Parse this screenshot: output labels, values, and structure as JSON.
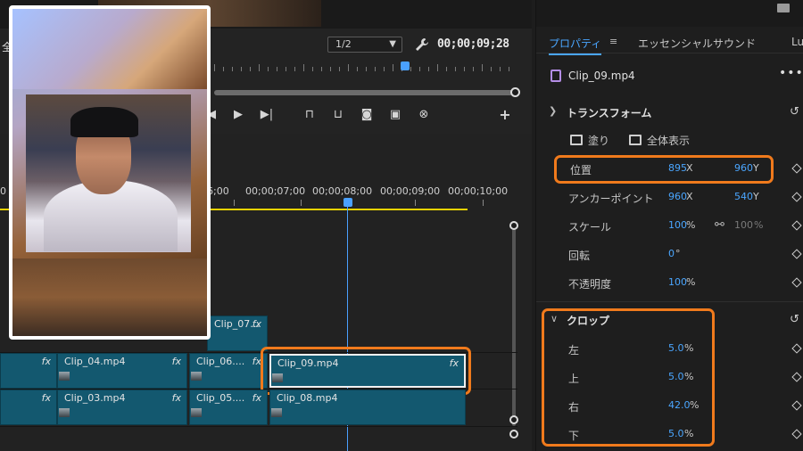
{
  "monitor": {
    "left_char": "全",
    "zoom": "1/2",
    "timecode": "00;00;09;28"
  },
  "timeline": {
    "ticks": [
      "6;00",
      "00;00;07;00",
      "00;00;08;00",
      "00;00;09;00",
      "00;00;10;00"
    ],
    "edge_tick": "0",
    "clips": {
      "c07": {
        "name": "Clip_07...",
        "fx": "fx"
      },
      "c04": {
        "name": "Clip_04.mp4",
        "fx": "fx"
      },
      "c06": {
        "name": "Clip_06....",
        "fx": "fx"
      },
      "c09": {
        "name": "Clip_09.mp4",
        "fx": "fx"
      },
      "c03": {
        "name": "Clip_03.mp4",
        "fx": "fx"
      },
      "c05": {
        "name": "Clip_05....",
        "fx": "fx"
      },
      "c08": {
        "name": "Clip_08.mp4",
        "fx": ""
      },
      "left_fx_top": "fx",
      "left_fx_bottom": "fx"
    }
  },
  "properties": {
    "tabs": [
      "プロパティ",
      "エッセンシャルサウンド",
      "Lum"
    ],
    "clip_name": "Clip_09.mp4",
    "transform": {
      "title": "トランスフォーム",
      "fill": "塗り",
      "fit": "全体表示",
      "position": {
        "label": "位置",
        "x": "895",
        "x_unit": "X",
        "y": "960",
        "y_unit": "Y"
      },
      "anchor": {
        "label": "アンカーポイント",
        "x": "960",
        "x_unit": "X",
        "y": "540",
        "y_unit": "Y"
      },
      "scale": {
        "label": "スケール",
        "value": "100",
        "unit": "%",
        "value2": "100",
        "unit2": "%"
      },
      "rotation": {
        "label": "回転",
        "value": "0",
        "unit": "°"
      },
      "opacity": {
        "label": "不透明度",
        "value": "100",
        "unit": "%"
      }
    },
    "crop": {
      "title": "クロップ",
      "left": {
        "label": "左",
        "value": "5.0",
        "unit": "%"
      },
      "top": {
        "label": "上",
        "value": "5.0",
        "unit": "%"
      },
      "right": {
        "label": "右",
        "value": "42.0",
        "unit": "%"
      },
      "bottom": {
        "label": "下",
        "value": "5.0",
        "unit": "%"
      }
    }
  },
  "colors": {
    "accent": "#4aa6ff",
    "highlight": "#f07a1c",
    "clip": "#13586f",
    "playhead": "#4aa0ff",
    "work_area": "#e8d200"
  },
  "icons": [
    "wrench-icon",
    "play-icon",
    "step-forward-icon",
    "lift-icon",
    "extract-icon",
    "camera-icon",
    "compare-icon",
    "settings-icon",
    "add-icon",
    "folder-icon",
    "clip-icon",
    "more-icon",
    "reset-icon",
    "diamond-icon",
    "link-icon",
    "chevron-down-icon",
    "hamburger-icon"
  ]
}
